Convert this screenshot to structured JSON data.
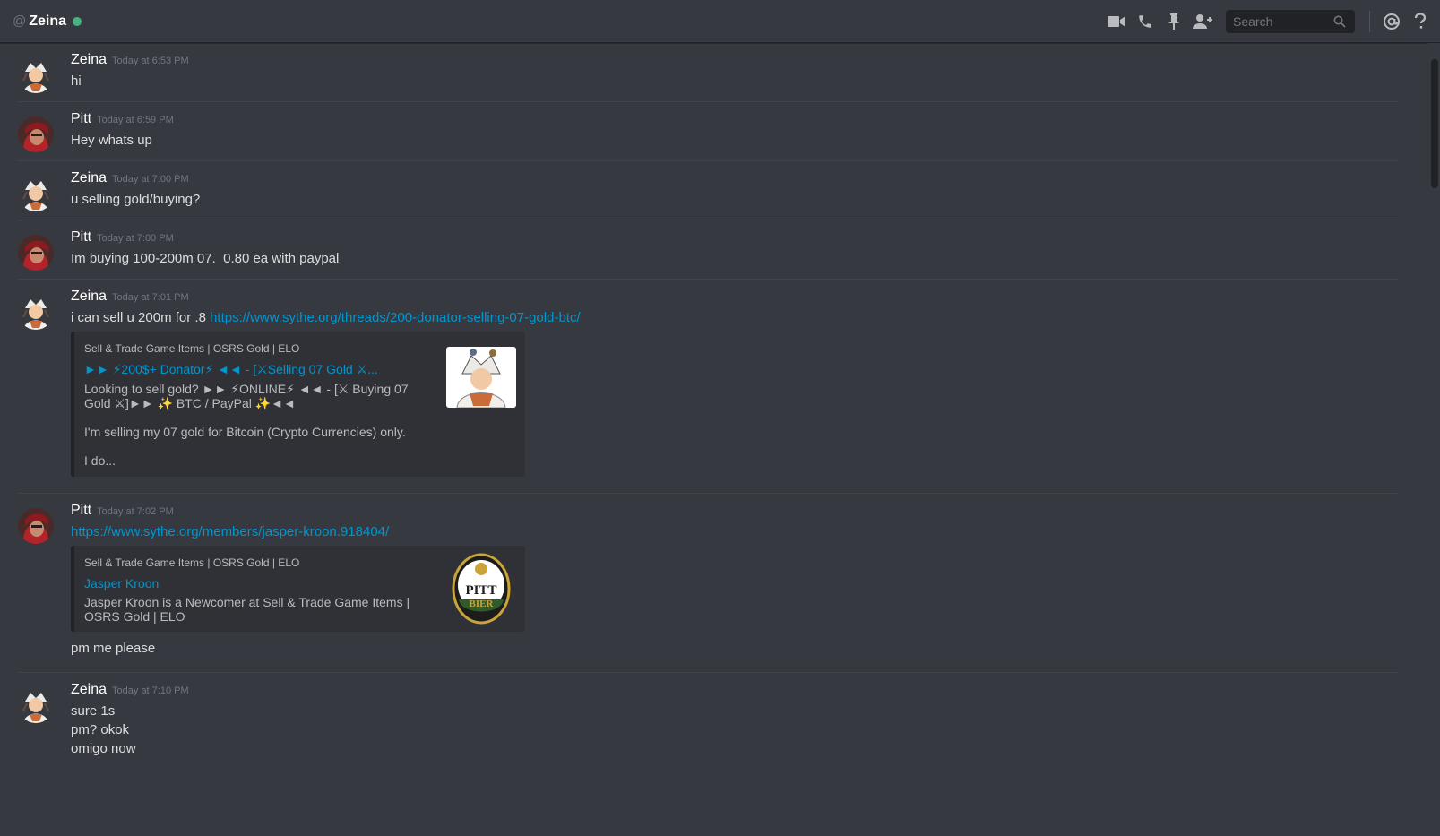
{
  "header": {
    "at_sign": "@",
    "channel_name": "Zeina",
    "search_placeholder": "Search",
    "icons": [
      "video-call-icon",
      "voice-call-icon",
      "pin-icon",
      "add-friend-icon",
      "search-icon",
      "mention-icon",
      "help-icon"
    ]
  },
  "colors": {
    "background": "#36393f",
    "header_border": "#202225",
    "online": "#43b581",
    "link": "#0096cf",
    "embed_background": "#2f3136"
  },
  "messages": [
    {
      "author": "Zeina",
      "time": "Today at 6:53 PM",
      "lines": [
        "hi"
      ]
    },
    {
      "author": "Pitt",
      "time": "Today at 6:59 PM",
      "lines": [
        "Hey whats up"
      ]
    },
    {
      "author": "Zeina",
      "time": "Today at 7:00 PM",
      "lines": [
        "u selling gold/buying?"
      ]
    },
    {
      "author": "Pitt",
      "time": "Today at 7:00 PM",
      "lines": [
        "Im buying 100-200m 07.  0.80 ea with paypal"
      ]
    },
    {
      "author": "Zeina",
      "time": "Today at 7:01 PM",
      "text": "i can sell u 200m for .8 ",
      "link": "https://www.sythe.org/threads/200-donator-selling-07-gold-btc/",
      "embed": {
        "provider": "Sell & Trade Game Items | OSRS Gold | ELO",
        "title": "►► ⚡200$+ Donator⚡ ◄◄ - [⚔Selling 07 Gold ⚔...",
        "description": "Looking to sell gold? ►► ⚡ONLINE⚡ ◄◄ - [⚔ Buying 07 Gold ⚔]►► ✨ BTC / PayPal ✨◄◄\n\nI'm selling my 07 gold for Bitcoin (Crypto Currencies) only.\n\nI do..."
      }
    },
    {
      "author": "Pitt",
      "time": "Today at 7:02 PM",
      "link": "https://www.sythe.org/members/jasper-kroon.918404/",
      "embed": {
        "provider": "Sell & Trade Game Items | OSRS Gold | ELO",
        "title": "Jasper Kroon",
        "description": "Jasper Kroon is a Newcomer at Sell & Trade Game Items | OSRS Gold | ELO",
        "thumb_text_top": "PITT",
        "thumb_text_bottom": "BIER"
      },
      "after": "pm me please"
    },
    {
      "author": "Zeina",
      "time": "Today at 7:10 PM",
      "lines": [
        "sure 1s",
        "pm? okok",
        "omigo now"
      ]
    }
  ]
}
